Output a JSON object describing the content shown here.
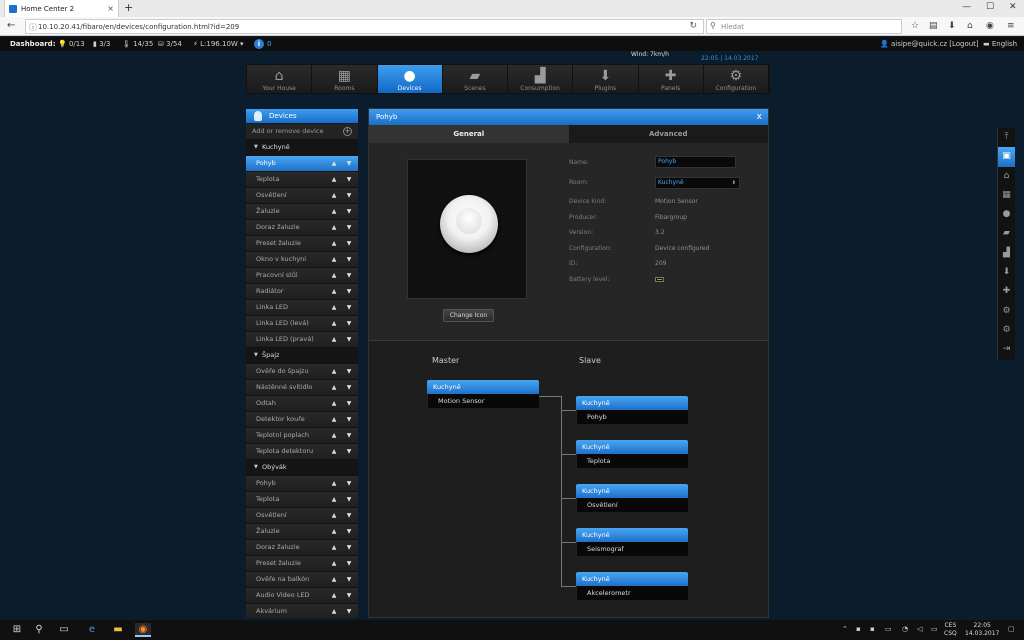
{
  "browser": {
    "tab_title": "Home Center 2",
    "tab_close": "×",
    "new_tab": "+",
    "url": "10.10.20.41/fibaro/en/devices/configuration.html?id=209",
    "search_placeholder": "Hledat",
    "win_min": "—",
    "win_max": "☐",
    "win_close": "✕"
  },
  "statusbar": {
    "dashboard_label": "Dashboard:",
    "lights": "0/13",
    "doors": "3/3",
    "temp": "14/35",
    "blinds": "3/54",
    "power": "L:196.10W",
    "info_count": "0",
    "user": "aisipe@quick.cz [Logout]",
    "language": "English"
  },
  "weather": {
    "wind": "Wind: 7km/h",
    "time": "22:05",
    "date": "14.03.2017"
  },
  "topmenu": [
    {
      "label": "Your House",
      "icon": "⌂"
    },
    {
      "label": "Rooms",
      "icon": "▦"
    },
    {
      "label": "Devices",
      "icon": "●",
      "active": true
    },
    {
      "label": "Scenes",
      "icon": "▰"
    },
    {
      "label": "Consumption",
      "icon": "▟"
    },
    {
      "label": "Plugins",
      "icon": "⬇"
    },
    {
      "label": "Panels",
      "icon": "✚"
    },
    {
      "label": "Configuration",
      "icon": "⚙"
    }
  ],
  "sidebar": {
    "title": "Devices",
    "add_label": "Add or remove device",
    "rows": [
      {
        "type": "section",
        "label": "Kuchyně"
      },
      {
        "type": "item",
        "label": "Pohyb",
        "selected": true
      },
      {
        "type": "item",
        "label": "Teplota"
      },
      {
        "type": "item",
        "label": "Osvětlení"
      },
      {
        "type": "item",
        "label": "Žaluzie"
      },
      {
        "type": "item",
        "label": "Doraz žaluzie"
      },
      {
        "type": "item",
        "label": "Preset žaluzie"
      },
      {
        "type": "item",
        "label": "Okno v kuchyni"
      },
      {
        "type": "item",
        "label": "Pracovní stůl"
      },
      {
        "type": "item",
        "label": "Radiátor"
      },
      {
        "type": "item",
        "label": "Linka LED"
      },
      {
        "type": "item",
        "label": "Linka LED (levá)"
      },
      {
        "type": "item",
        "label": "Linka LED (pravá)"
      },
      {
        "type": "section",
        "label": "Špajz"
      },
      {
        "type": "item",
        "label": "Ověře do špajzu"
      },
      {
        "type": "item",
        "label": "Nástěnné svítidlo"
      },
      {
        "type": "item",
        "label": "Odtah"
      },
      {
        "type": "item",
        "label": "Detektor kouře"
      },
      {
        "type": "item",
        "label": "Teplotní poplach"
      },
      {
        "type": "item",
        "label": "Teplota detektoru"
      },
      {
        "type": "section",
        "label": "Obývák"
      },
      {
        "type": "item",
        "label": "Pohyb"
      },
      {
        "type": "item",
        "label": "Teplota"
      },
      {
        "type": "item",
        "label": "Osvětlení"
      },
      {
        "type": "item",
        "label": "Žaluzie"
      },
      {
        "type": "item",
        "label": "Doraz žaluzie"
      },
      {
        "type": "item",
        "label": "Preset žaluzie"
      },
      {
        "type": "item",
        "label": "Ověře na balkón"
      },
      {
        "type": "item",
        "label": "Audio Video LED"
      },
      {
        "type": "item",
        "label": "Akvárium"
      }
    ]
  },
  "panel": {
    "title": "Pohyb",
    "close": "x",
    "tab_general": "General",
    "tab_advanced": "Advanced",
    "change_icon": "Change Icon",
    "name_label": "Name:",
    "name_value": "Pohyb",
    "room_label": "Room:",
    "room_value": "Kuchyně",
    "kind_label": "Device kind:",
    "kind_value": "Motion Sensor",
    "producer_label": "Producer:",
    "producer_value": "Fibargroup",
    "version_label": "Version:",
    "version_value": "3.2",
    "config_label": "Configuration:",
    "config_value": "Device configured",
    "id_label": "ID:",
    "id_value": "209",
    "battery_label": "Battery level:"
  },
  "association": {
    "master_label": "Master",
    "slave_label": "Slave",
    "master": {
      "room": "Kuchyně",
      "device": "Motion Sensor"
    },
    "slaves": [
      {
        "room": "Kuchyně",
        "device": "Pohyb"
      },
      {
        "room": "Kuchyně",
        "device": "Teplota"
      },
      {
        "room": "Kuchyně",
        "device": "Osvětlení"
      },
      {
        "room": "Kuchyně",
        "device": "Seismograf"
      },
      {
        "room": "Kuchyně",
        "device": "Akcelerometr"
      }
    ]
  },
  "taskbar": {
    "lang": "CES",
    "lang2": "CSQ",
    "time": "22:05",
    "date": "14.03.2017"
  },
  "colors": {
    "accent": "#1d71c8",
    "accent_light": "#4aa6f2",
    "background": "#0b1c2c",
    "battery": "#5fc934"
  }
}
